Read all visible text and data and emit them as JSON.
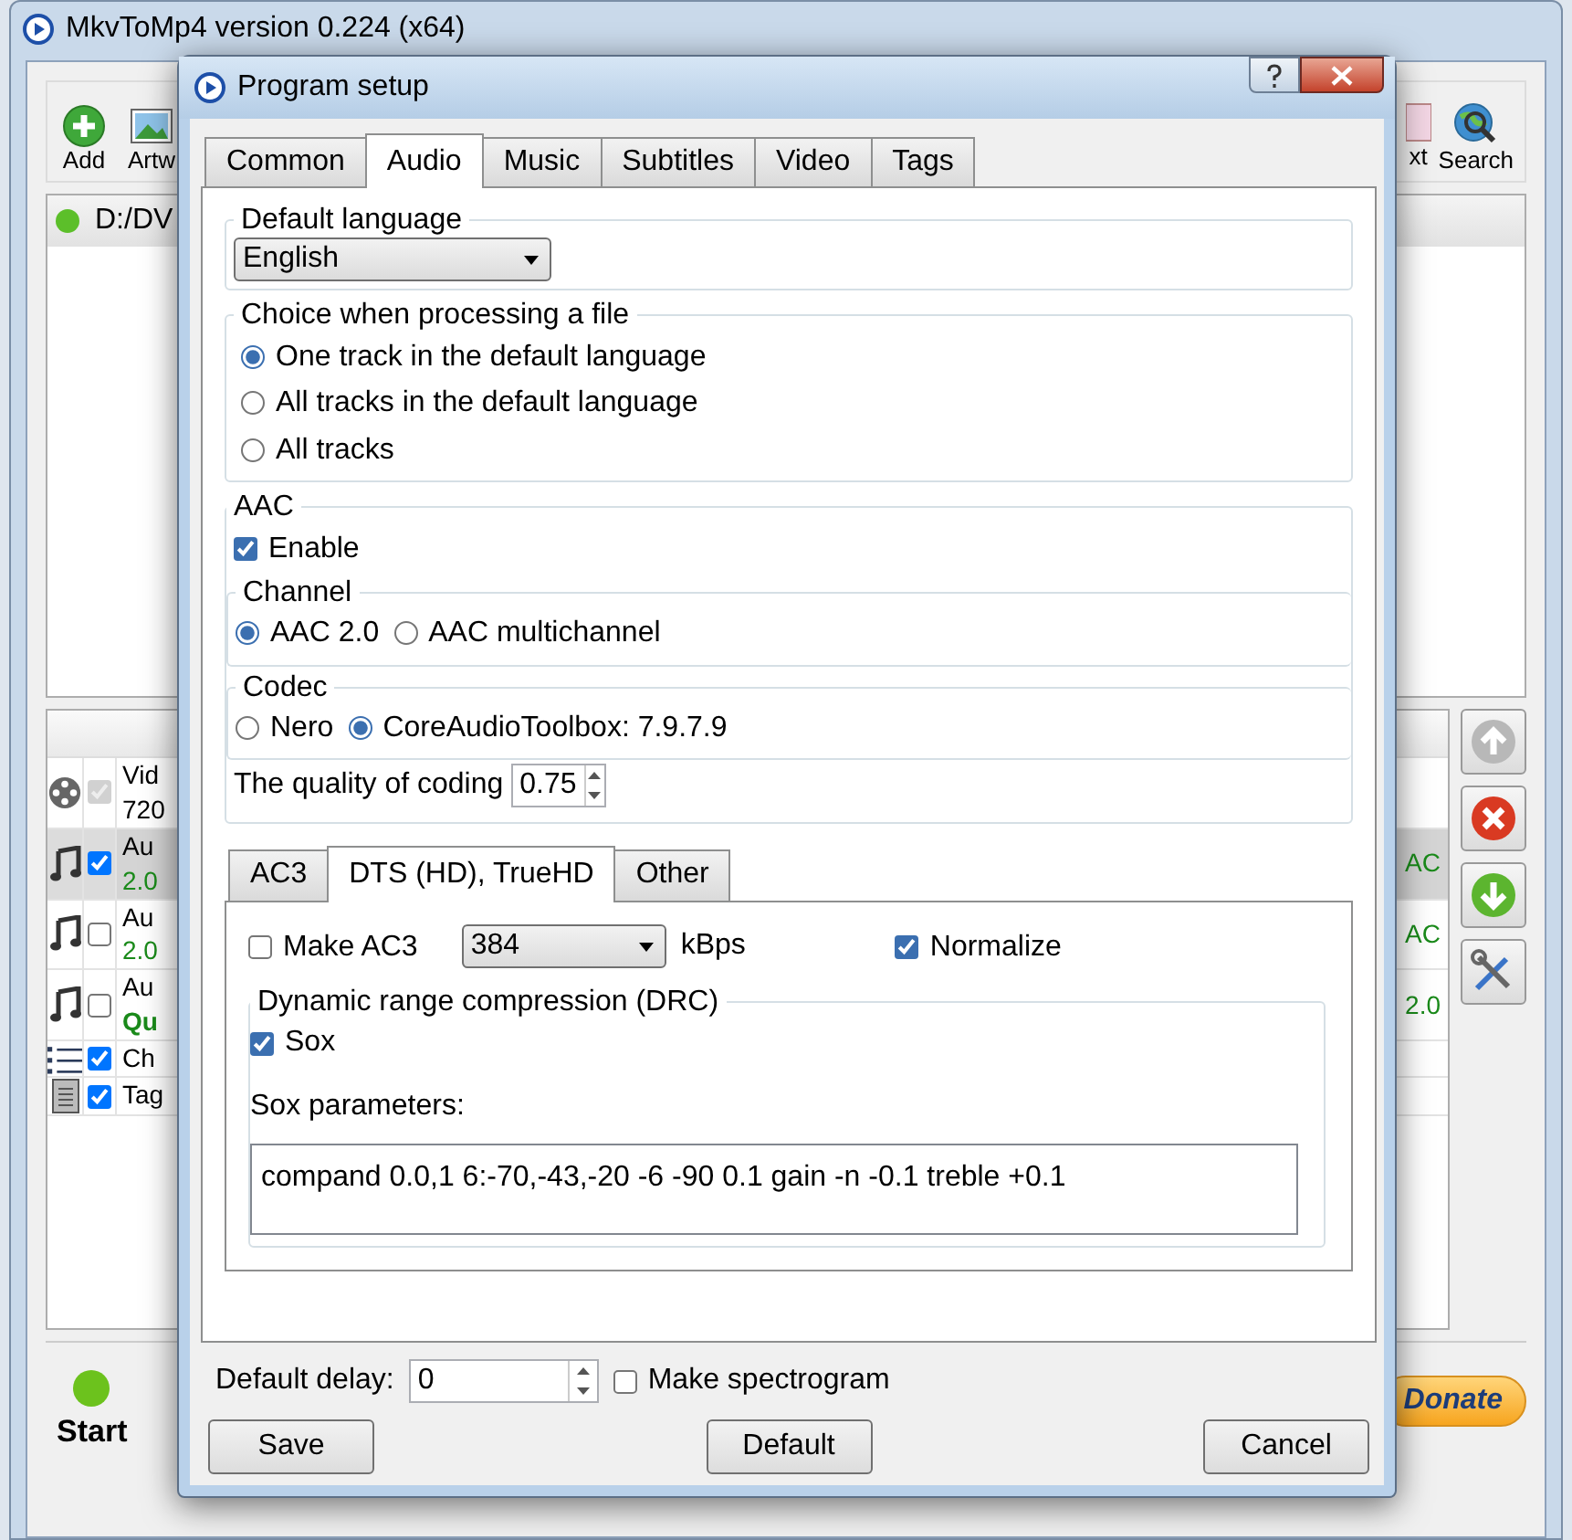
{
  "main_window": {
    "title": "MkvToMp4 version 0.224 (x64)",
    "toolbar": [
      {
        "label": "Add"
      },
      {
        "label": "Artw"
      },
      {
        "label": "xt"
      },
      {
        "label": "Search"
      }
    ],
    "file_list": [
      {
        "text": "D:/DV"
      }
    ],
    "tracks": [
      {
        "kind": "video",
        "checked": true,
        "disabled": true,
        "selected": false,
        "title": "Vid",
        "detail": "720",
        "color": "#000000",
        "bold": false
      },
      {
        "kind": "audio",
        "checked": true,
        "disabled": false,
        "selected": true,
        "title": "Au",
        "detail": "2.0",
        "color": "#1a8a1a",
        "bold": false,
        "right_text": "AC"
      },
      {
        "kind": "audio",
        "checked": false,
        "disabled": false,
        "selected": false,
        "title": "Au",
        "detail": "2.0",
        "color": "#1a8a1a",
        "bold": false,
        "right_text": "AC"
      },
      {
        "kind": "audio",
        "checked": false,
        "disabled": false,
        "selected": false,
        "title": "Au",
        "detail": "Qu",
        "color": "#1a8a1a",
        "bold": true,
        "right_text": "2.0"
      },
      {
        "kind": "chapters",
        "checked": true,
        "disabled": false,
        "selected": false,
        "title": "Ch"
      },
      {
        "kind": "tags",
        "checked": true,
        "disabled": false,
        "selected": false,
        "title": "Tag"
      }
    ],
    "start": "Start",
    "donate": "Donate"
  },
  "dialog": {
    "title": "Program setup",
    "tabs": [
      {
        "label": "Common",
        "selected": false
      },
      {
        "label": "Audio",
        "selected": true
      },
      {
        "label": "Music",
        "selected": false
      },
      {
        "label": "Subtitles",
        "selected": false
      },
      {
        "label": "Video",
        "selected": false
      },
      {
        "label": "Tags",
        "selected": false
      }
    ],
    "default_language": {
      "label": "Default language",
      "value": "English"
    },
    "choice": {
      "label": "Choice when processing a file",
      "options": [
        {
          "label": "One track in the default language",
          "selected": true
        },
        {
          "label": "All tracks in the default language",
          "selected": false
        },
        {
          "label": "All tracks",
          "selected": false
        }
      ]
    },
    "aac": {
      "label": "AAC",
      "enable": {
        "label": "Enable",
        "checked": true
      },
      "channel": {
        "label": "Channel",
        "options": [
          {
            "label": "AAC 2.0",
            "selected": true
          },
          {
            "label": "AAC multichannel",
            "selected": false
          }
        ]
      },
      "codec": {
        "label": "Codec",
        "options": [
          {
            "label": "Nero",
            "selected": false
          },
          {
            "label": "CoreAudioToolbox: 7.9.7.9",
            "selected": true
          }
        ]
      },
      "quality": {
        "label": "The quality of coding",
        "value": "0.75"
      }
    },
    "sub_tabs": [
      {
        "label": "AC3",
        "selected": false
      },
      {
        "label": "DTS (HD), TrueHD",
        "selected": true
      },
      {
        "label": "Other",
        "selected": false
      }
    ],
    "make_ac3": {
      "label": "Make AC3",
      "checked": false
    },
    "bitrate": {
      "value": "384",
      "unit": "kBps"
    },
    "normalize": {
      "label": "Normalize",
      "checked": true
    },
    "drc": {
      "label": "Dynamic range compression (DRC)",
      "sox": {
        "label": "Sox",
        "checked": true
      },
      "params_label": "Sox parameters:",
      "params": "compand 0.0,1 6:-70,-43,-20 -6 -90 0.1 gain -n -0.1 treble +0.1"
    },
    "default_delay": {
      "label": "Default delay:",
      "value": "0"
    },
    "spectrogram": {
      "label": "Make spectrogram",
      "checked": false
    },
    "buttons": [
      "Save",
      "Default",
      "Cancel"
    ]
  }
}
